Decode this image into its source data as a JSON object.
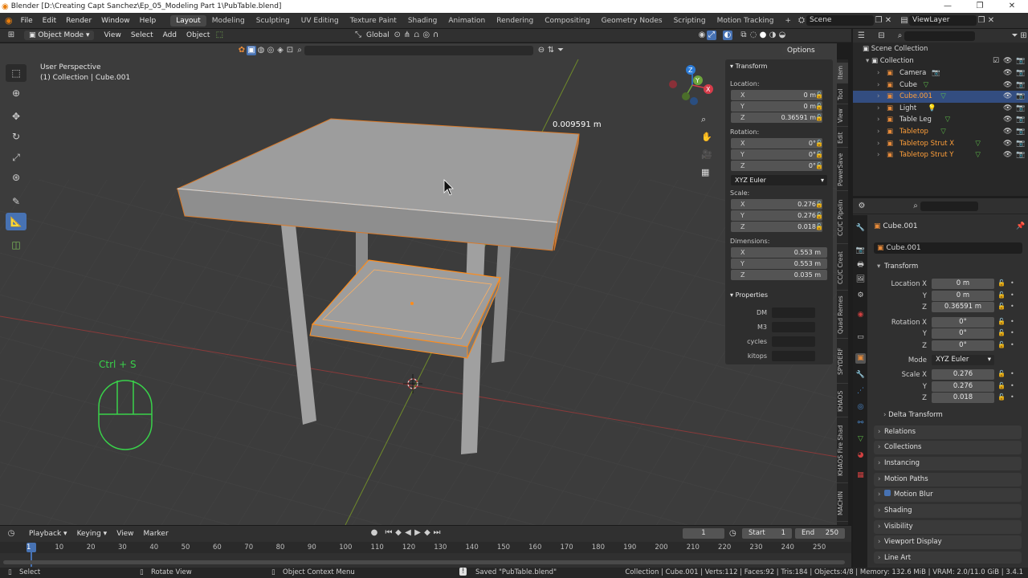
{
  "window": {
    "title": "Blender [D:\\Creating Capt Sanchez\\Ep_05_Modeling Part 1\\PubTable.blend]"
  },
  "menu": [
    "File",
    "Edit",
    "Render",
    "Window",
    "Help"
  ],
  "workspaces": [
    "Layout",
    "Modeling",
    "Sculpting",
    "UV Editing",
    "Texture Paint",
    "Shading",
    "Animation",
    "Rendering",
    "Compositing",
    "Geometry Nodes",
    "Scripting",
    "Motion Tracking"
  ],
  "active_workspace": "Layout",
  "scene": {
    "label": "Scene",
    "view_layer": "ViewLayer"
  },
  "viewport_header": {
    "mode": "Object Mode",
    "menus": [
      "View",
      "Select",
      "Add",
      "Object"
    ],
    "orientation": "Global",
    "options": "Options"
  },
  "viewport": {
    "perspective": "User Perspective",
    "collection_info": "(1) Collection | Cube.001",
    "measure": "0.009591 m",
    "shortcut_hint": "Ctrl + S"
  },
  "npanel": {
    "transform_title": "Transform",
    "location_label": "Location:",
    "location": {
      "x": "0 m",
      "y": "0 m",
      "z": "0.36591 m"
    },
    "rotation_label": "Rotation:",
    "rotation": {
      "x": "0°",
      "y": "0°",
      "z": "0°"
    },
    "rotation_mode": "XYZ Euler",
    "scale_label": "Scale:",
    "scale": {
      "x": "0.276",
      "y": "0.276",
      "z": "0.018"
    },
    "dimensions_label": "Dimensions:",
    "dimensions": {
      "x": "0.553 m",
      "y": "0.553 m",
      "z": "0.035 m"
    },
    "properties_title": "Properties",
    "properties": [
      "DM",
      "M3",
      "cycles",
      "kitops"
    ],
    "axes": [
      "X",
      "Y",
      "Z"
    ]
  },
  "side_tabs": [
    "Item",
    "Tool",
    "View",
    "Edit",
    "PowerSave",
    "CC/C Pipelin",
    "CC/C Creat",
    "Quad Remes",
    "SPYDERF",
    "KHAOS",
    "KHAOS Fire Shad",
    "MACHIN"
  ],
  "outliner": {
    "root": "Scene Collection",
    "collection": "Collection",
    "items": [
      {
        "name": "Camera",
        "selected": false,
        "orange": false
      },
      {
        "name": "Cube",
        "selected": false,
        "orange": false
      },
      {
        "name": "Cube.001",
        "selected": true,
        "orange": true
      },
      {
        "name": "Light",
        "selected": false,
        "orange": false
      },
      {
        "name": "Table Leg",
        "selected": false,
        "orange": false
      },
      {
        "name": "Tabletop",
        "selected": false,
        "orange": true
      },
      {
        "name": "Tabletop Strut X",
        "selected": false,
        "orange": true
      },
      {
        "name": "Tabletop Strut Y",
        "selected": false,
        "orange": true
      }
    ]
  },
  "properties": {
    "object_name": "Cube.001",
    "object_field": "Cube.001",
    "transform_title": "Transform",
    "location_label": "Location X",
    "location": [
      "0 m",
      "0 m",
      "0.36591 m"
    ],
    "rotation_label": "Rotation X",
    "rotation": [
      "0°",
      "0°",
      "0°"
    ],
    "mode_label": "Mode",
    "mode": "XYZ Euler",
    "scale_label": "Scale X",
    "scale": [
      "0.276",
      "0.276",
      "0.018"
    ],
    "y_label": "Y",
    "z_label": "Z",
    "sections": [
      "Delta Transform",
      "Relations",
      "Collections",
      "Instancing",
      "Motion Paths",
      "Motion Blur",
      "Shading",
      "Visibility",
      "Viewport Display",
      "Line Art"
    ]
  },
  "timeline": {
    "menus": [
      "Playback",
      "Keying",
      "View",
      "Marker"
    ],
    "current_frame": "1",
    "start_label": "Start",
    "start": "1",
    "end_label": "End",
    "end": "250",
    "ticks": [
      "1",
      "10",
      "20",
      "30",
      "40",
      "50",
      "60",
      "70",
      "80",
      "90",
      "100",
      "110",
      "120",
      "130",
      "140",
      "150",
      "160",
      "170",
      "180",
      "190",
      "200",
      "210",
      "220",
      "230",
      "240",
      "250"
    ]
  },
  "statusbar": {
    "select": "Select",
    "rotate": "Rotate View",
    "context": "Object Context Menu",
    "saved": "Saved \"PubTable.blend\"",
    "stats": "Collection | Cube.001 | Verts:112 | Faces:92 | Tris:184 | Objects:4/8 | Memory: 132.6 MiB | VRAM: 2.0/11.0 GiB | 3.4.1"
  },
  "colors": {
    "accent": "#4772b3",
    "selection": "#ff8c1a",
    "header": "#303030",
    "viewport": "#3c3c3c"
  }
}
